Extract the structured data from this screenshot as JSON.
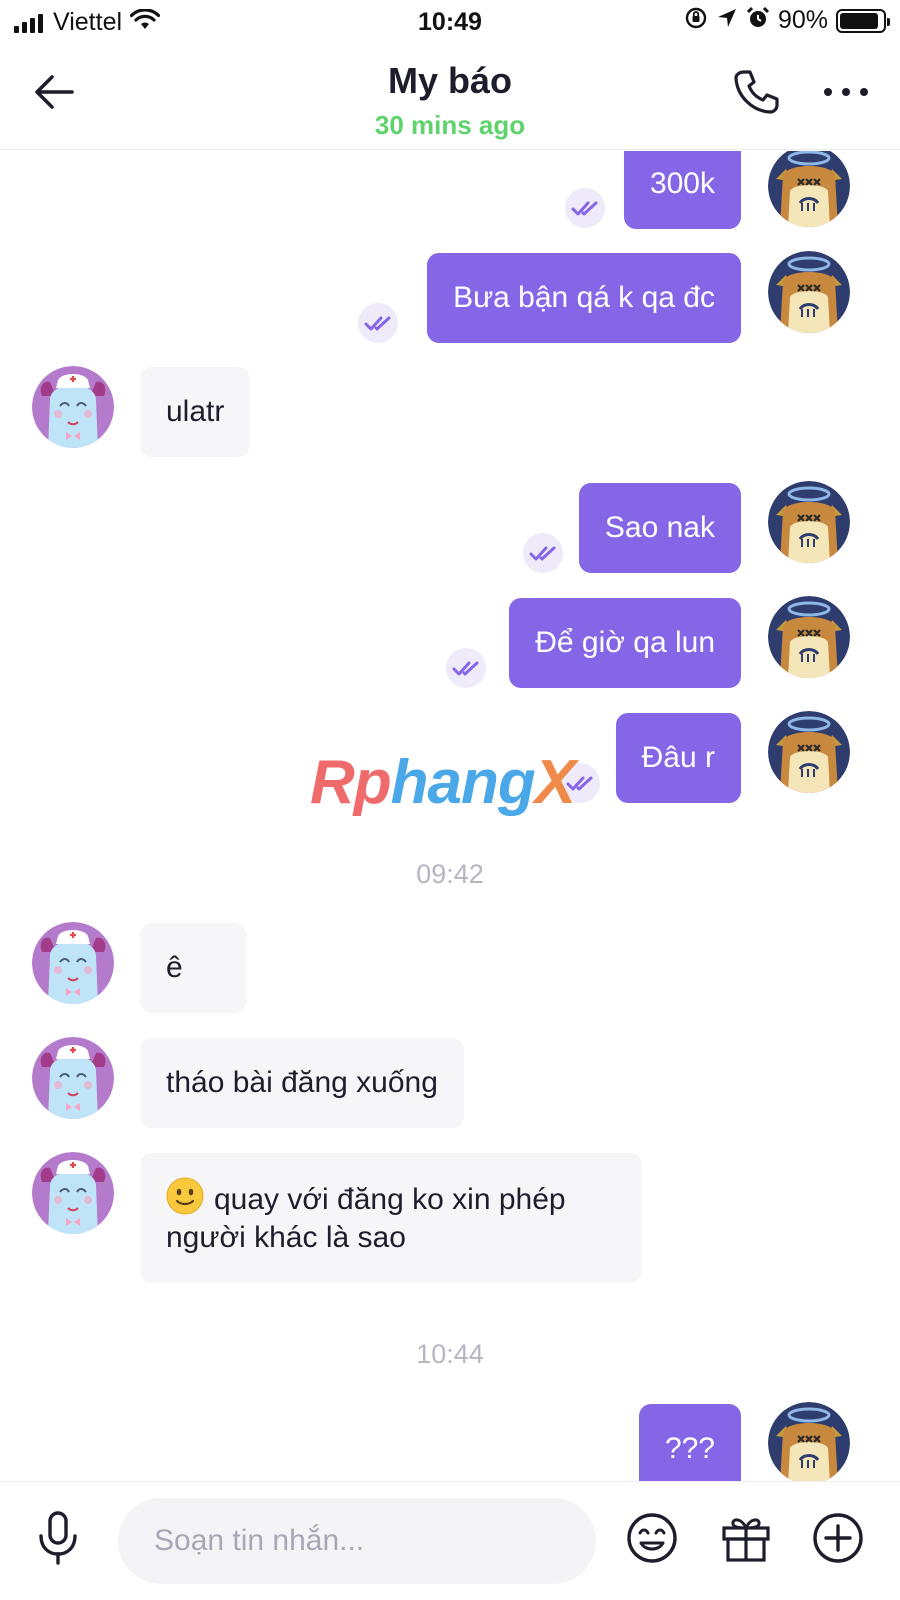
{
  "status_bar": {
    "carrier": "Viettel",
    "time": "10:49",
    "battery": "90%",
    "battery_level": 0.9
  },
  "header": {
    "title": "My báo",
    "subtitle": "30 mins ago",
    "subtitle_color": "#5fd36b"
  },
  "colors": {
    "outgoing_bubble": "#8566e6",
    "incoming_bubble": "#f6f6f9"
  },
  "messages": [
    {
      "direction": "out",
      "text": "300k",
      "status": "read"
    },
    {
      "direction": "out",
      "text": "Bưa bận qá k qa đc",
      "status": "read"
    },
    {
      "direction": "in",
      "text": "ulatr"
    },
    {
      "direction": "out",
      "text": "Sao nak",
      "status": "read"
    },
    {
      "direction": "out",
      "text": "Để giờ qa lun",
      "status": "read"
    },
    {
      "direction": "out",
      "text": "Đâu r",
      "status": "read"
    },
    {
      "direction": "in",
      "text": "ê"
    },
    {
      "direction": "in",
      "text": "tháo bài đăng xuống"
    },
    {
      "direction": "in",
      "line1": "quay với đăng ko xin phép",
      "line2": "người khác là sao",
      "emoji": "slightly-smiling-face"
    },
    {
      "direction": "out",
      "text": "???"
    }
  ],
  "time_separators": [
    "09:42",
    "10:44"
  ],
  "watermark": {
    "part1": "Rp",
    "part2": "hang",
    "part3": "X"
  },
  "composer": {
    "placeholder": "Soạn tin nhắn..."
  },
  "icons": {
    "back": "arrow-left-icon",
    "call": "phone-icon",
    "more": "more-dots-icon",
    "mic": "microphone-icon",
    "emoji": "emoji-icon",
    "gift": "gift-icon",
    "add": "plus-circle-icon",
    "read": "double-check-icon"
  }
}
